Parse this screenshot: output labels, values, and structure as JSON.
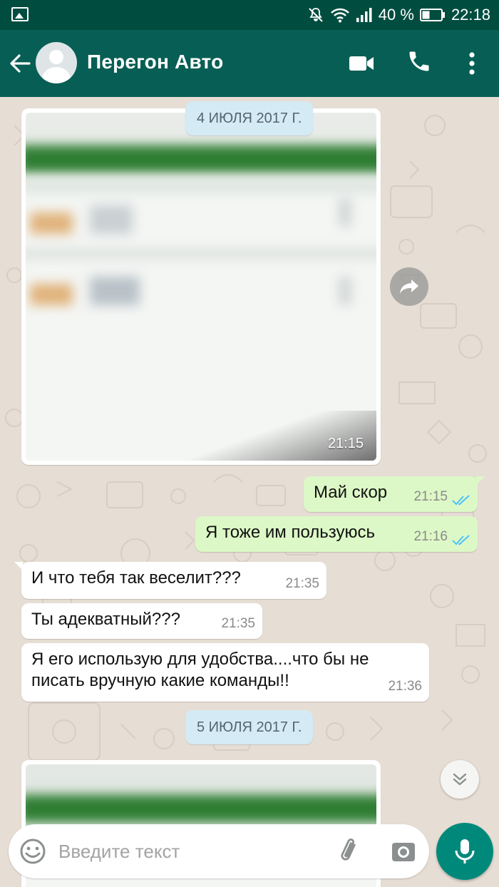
{
  "status_bar": {
    "battery_percent": "40 %",
    "time": "22:18",
    "icons": [
      "gallery-icon",
      "mute-icon",
      "wifi-icon",
      "signal-icon",
      "battery-icon"
    ]
  },
  "header": {
    "contact_name": "Перегон Авто",
    "icons": [
      "back-arrow-icon",
      "avatar-icon",
      "video-call-icon",
      "phone-icon",
      "more-vert-icon"
    ]
  },
  "chat": {
    "date_1": "4 ИЮЛЯ 2017 Г.",
    "image_message_1": {
      "time": "21:15"
    },
    "messages": [
      {
        "direction": "out",
        "text": "Май скор",
        "time": "21:15",
        "status": "read"
      },
      {
        "direction": "out",
        "text": "Я тоже им пользуюсь",
        "time": "21:16",
        "status": "read"
      },
      {
        "direction": "in",
        "text": "И что тебя так веселит???",
        "time": "21:35"
      },
      {
        "direction": "in",
        "text": "Ты адекватный???",
        "time": "21:35"
      },
      {
        "direction": "in",
        "text_line1": "Я его использую для удобства....что бы не",
        "text_line2": "писать вручную какие команды!!",
        "time": "21:36"
      }
    ],
    "date_2": "5 ИЮЛЯ 2017 Г."
  },
  "composer": {
    "placeholder": "Введите текст",
    "icons": [
      "emoji-icon",
      "attach-icon",
      "camera-icon",
      "mic-icon"
    ]
  },
  "colors": {
    "status_bar": "#004d40",
    "app_bar": "#075e54",
    "outgoing_bubble": "#dcf8c6",
    "incoming_bubble": "#ffffff",
    "read_ticks": "#4fc3f7",
    "mic_button": "#00897b"
  }
}
